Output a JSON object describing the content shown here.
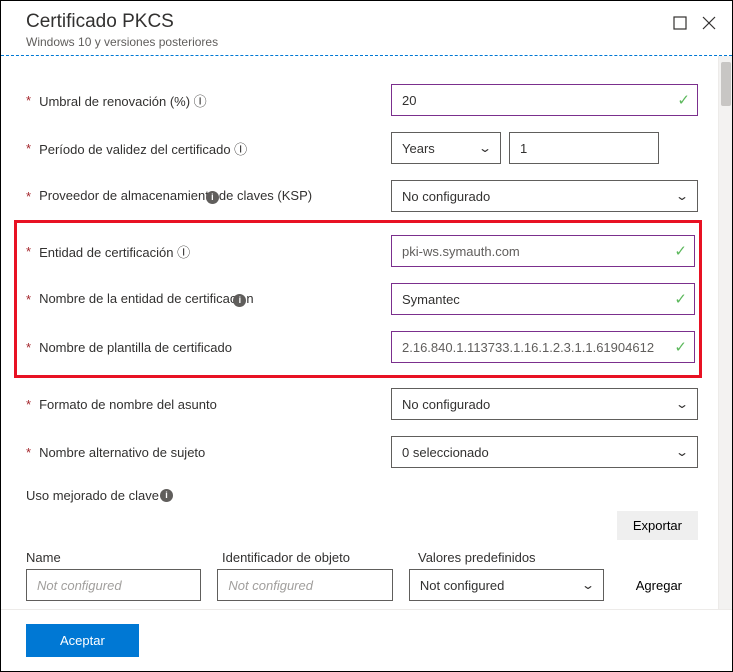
{
  "header": {
    "title": "Certificado PKCS",
    "subtitle": "Windows 10 y versiones posteriores"
  },
  "fields": {
    "renewal_label": "Umbral de renovación (%) Ⓘ",
    "renewal_value": "20",
    "validity_label": "Período de validez del certificado Ⓘ",
    "validity_unit": "Years",
    "validity_value": "1",
    "ksp_label": "Proveedor de almacenamiento de claves (KSP)",
    "ksp_value": "No configurado",
    "ca_label": "Entidad de certificación Ⓘ",
    "ca_value": "pki-ws.symauth.com",
    "ca_name_label": "Nombre de la entidad de certificación",
    "ca_name_value": "Symantec",
    "tmpl_label": "Nombre de plantilla de certificado",
    "tmpl_value": "2.16.840.1.113733.1.16.1.2.3.1.1.61904612",
    "subj_fmt_label": "Formato de nombre del asunto",
    "subj_fmt_value": "No configurado",
    "san_label": "Nombre alternativo de sujeto",
    "san_value": "0 seleccionado",
    "eku_label": "Uso mejorado de clave"
  },
  "eku_table": {
    "col_name": "Name",
    "col_oid": "Identificador de objeto",
    "col_pred": "Valores predefinidos",
    "placeholder": "Not configured",
    "dropdown_value": "Not configured"
  },
  "buttons": {
    "export": "Exportar",
    "add": "Agregar",
    "accept": "Aceptar"
  }
}
